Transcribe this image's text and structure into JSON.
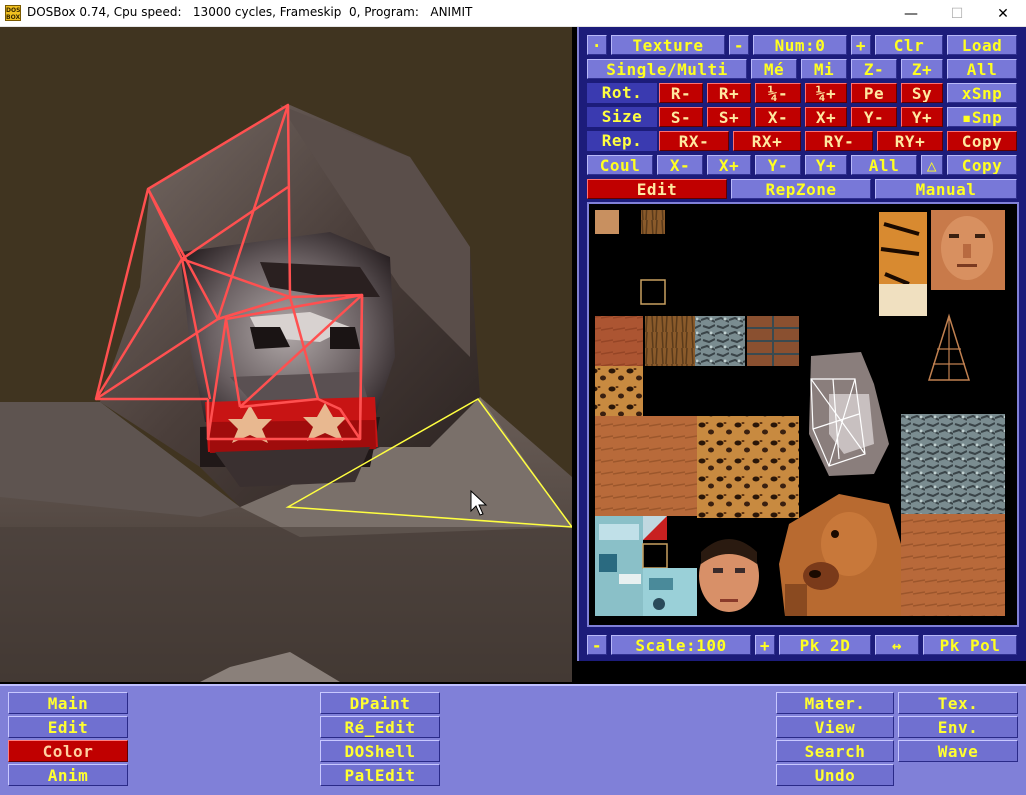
{
  "window": {
    "title": "DOSBox 0.74, Cpu speed:   13000 cycles, Frameskip  0, Program:   ANIMIT",
    "icon": "dosbox-icon",
    "controls": {
      "minimize": "—",
      "maximize": "☐",
      "close": "✕"
    }
  },
  "texture_panel": {
    "row1": {
      "toggle": "·",
      "texture": "Texture",
      "minus": "-",
      "num": "Num:0",
      "plus": "+",
      "clr": "Clr",
      "load": "Load"
    },
    "row2": {
      "single_multi": "Single/Multi",
      "me": "Mé",
      "mi": "Mi",
      "z_minus": "Z-",
      "z_plus": "Z+",
      "all": "All"
    },
    "row3": {
      "label": "Rot.",
      "r_minus": "R-",
      "r_plus": "R+",
      "quarter_minus": "¼-",
      "quarter_plus": "¼+",
      "pe": "Pe",
      "sy": "Sy",
      "xsnp": "xSnp"
    },
    "row4": {
      "label": "Size",
      "s_minus": "S-",
      "s_plus": "S+",
      "x_minus": "X-",
      "x_plus": "X+",
      "y_minus": "Y-",
      "y_plus": "Y+",
      "snp": "▪Snp"
    },
    "row5": {
      "label": "Rep.",
      "rx_minus": "RX-",
      "rx_plus": "RX+",
      "ry_minus": "RY-",
      "ry_plus": "RY+",
      "copy": "Copy"
    },
    "row6": {
      "coul": "Coul",
      "x_minus": "X-",
      "x_plus": "X+",
      "y_minus": "Y-",
      "y_plus": "Y+",
      "all": "All",
      "delta": "△",
      "copy": "Copy"
    },
    "row7": {
      "edit": "Edit",
      "repzone": "RepZone",
      "manual": "Manual"
    },
    "bottom": {
      "minus": "-",
      "scale": "Scale:100",
      "plus": "+",
      "pk2d": "Pk 2D",
      "arrows": "↔",
      "pkpol": "Pk Pol"
    }
  },
  "bottom_menu": {
    "main": "Main",
    "edit": "Edit",
    "color": "Color",
    "anim": "Anim",
    "dpaint": "DPaint",
    "re_edit": "Ré_Edit",
    "doshell": "DOShell",
    "paledit": "PalEdit",
    "mater": "Mater.",
    "view": "View",
    "search": "Search",
    "undo": "Undo",
    "tex": "Tex.",
    "env": "Env.",
    "wave": "Wave"
  },
  "colors": {
    "panel_bg": "#1c1c7a",
    "button_blue": "#7878d8",
    "button_red": "#c00000",
    "button_text": "#ffff20",
    "wireframe": "#ff5050",
    "selection": "#ffff40"
  }
}
